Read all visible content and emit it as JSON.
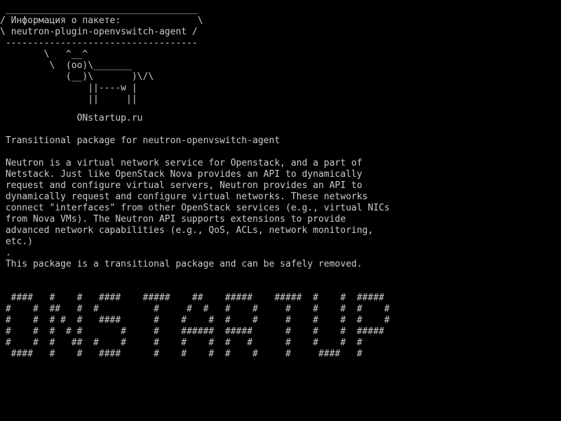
{
  "terminal": {
    "background": "#000000",
    "foreground": "#cccccc"
  },
  "cowsay": {
    "bubble": " ___________________________________\n/ Информация о пакете:              \\\n\\ neutron-plugin-openvswitch-agent /\n -----------------------------------\n        \\   ^__^\n         \\  (oo)\\_______\n            (__)\\       )\\/\\\n                ||----w |\n                ||     ||",
    "site": "              ONstartup.ru"
  },
  "package": {
    "summary": " Transitional package for neutron-openvswitch-agent",
    "description": " Neutron is a virtual network service for Openstack, and a part of\n Netstack. Just like OpenStack Nova provides an API to dynamically\n request and configure virtual servers, Neutron provides an API to\n dynamically request and configure virtual networks. These networks\n connect \"interfaces\" from other OpenStack services (e.g., virtual NICs\n from Nova VMs). The Neutron API supports extensions to provide\n advanced network capabilities (e.g., QoS, ACLs, network monitoring,\n etc.)\n .\n This package is a transitional package and can be safely removed."
  },
  "banner_art": "  ####   #    #   ####    #####    ##    #####    #####  #    #  #####\n #    #  ##   #  #          #     #  #   #    #     #    #    #  #    #\n #    #  # #  #   ####      #    #    #  #    #     #    #    #  #    #\n #    #  #  # #       #     #    ######  #####      #    #    #  #####\n #    #  #   ##  #    #     #    #    #  #   #      #    #    #  #\n  ####   #    #   ####      #    #    #  #    #     #     ####   #"
}
